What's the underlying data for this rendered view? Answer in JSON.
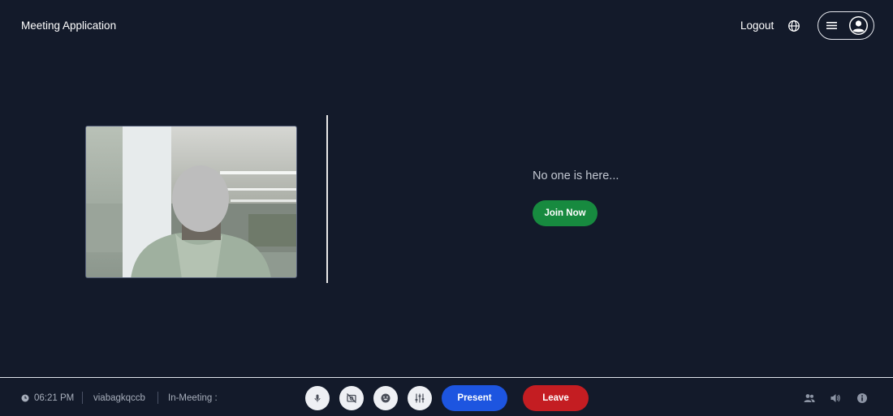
{
  "header": {
    "app_title": "Meeting Application",
    "logout_label": "Logout",
    "icons": [
      "globe-icon",
      "hamburger-icon",
      "user-avatar-icon"
    ]
  },
  "main": {
    "self_video_label": "",
    "empty_message": "No one is here...",
    "join_label": "Join Now"
  },
  "footer": {
    "time": "06:21 PM",
    "meeting_code": "viabagkqccb",
    "status_label": "In-Meeting :",
    "controls": [
      "microphone-icon",
      "camera-off-icon",
      "emoji-reaction-icon",
      "settings-sliders-icon"
    ],
    "present_label": "Present",
    "leave_label": "Leave",
    "right_icons": [
      "participants-icon",
      "volume-icon",
      "info-icon"
    ]
  },
  "colors": {
    "background": "#131a2a",
    "join": "#178a3f",
    "present": "#1d55e0",
    "leave": "#c41d22"
  }
}
